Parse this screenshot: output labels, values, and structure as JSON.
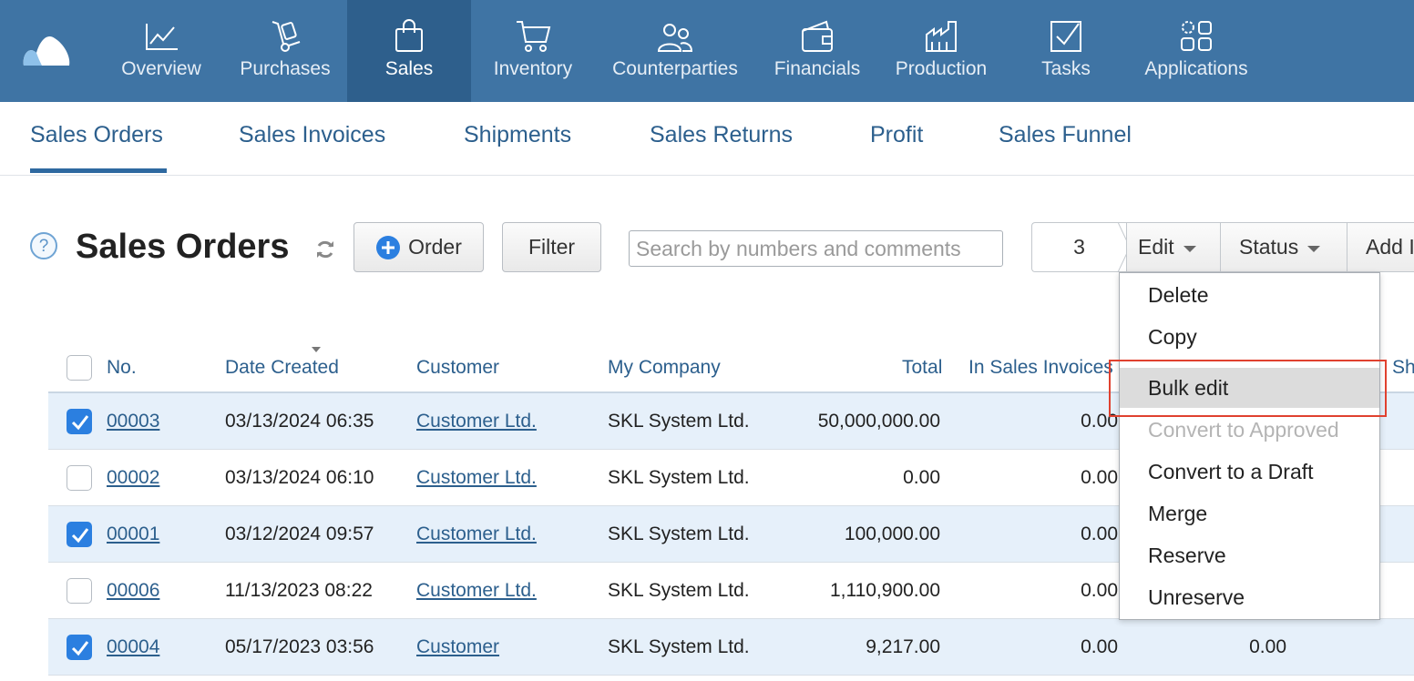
{
  "topnav": {
    "items": [
      {
        "label": "Overview",
        "icon": "chart-line-icon"
      },
      {
        "label": "Purchases",
        "icon": "hand-truck-icon"
      },
      {
        "label": "Sales",
        "icon": "shopping-bag-icon"
      },
      {
        "label": "Inventory",
        "icon": "cart-icon"
      },
      {
        "label": "Counterparties",
        "icon": "people-icon"
      },
      {
        "label": "Financials",
        "icon": "wallet-icon"
      },
      {
        "label": "Production",
        "icon": "factory-icon"
      },
      {
        "label": "Tasks",
        "icon": "checkbox-icon"
      },
      {
        "label": "Applications",
        "icon": "apps-grid-icon"
      }
    ],
    "active": "Sales",
    "bg_color": "#3f74a4",
    "active_color": "#2e5f8c"
  },
  "subnav": {
    "tabs": [
      "Sales Orders",
      "Sales Invoices",
      "Shipments",
      "Sales Returns",
      "Profit",
      "Sales Funnel"
    ],
    "active": "Sales Orders"
  },
  "page": {
    "help": "?",
    "title": "Sales Orders",
    "order_button": "Order",
    "filter_button": "Filter",
    "search_placeholder": "Search by numbers and comments",
    "selected_count": "3",
    "edit_button": "Edit",
    "status_button": "Status",
    "add_button": "Add I"
  },
  "table": {
    "headers": [
      "No.",
      "Date Created",
      "Customer",
      "My Company",
      "Total",
      "In Sales Invoices",
      "Sh"
    ],
    "rows": [
      {
        "checked": true,
        "no": "00003",
        "date": "03/13/2024 06:35",
        "customer": "Customer Ltd.",
        "company": "SKL System Ltd.",
        "total": "50,000,000.00",
        "invoices": "0.00",
        "extra": ""
      },
      {
        "checked": false,
        "no": "00002",
        "date": "03/13/2024 06:10",
        "customer": "Customer Ltd.",
        "company": "SKL System Ltd.",
        "total": "0.00",
        "invoices": "0.00",
        "extra": ""
      },
      {
        "checked": true,
        "no": "00001",
        "date": "03/12/2024 09:57",
        "customer": "Customer Ltd.",
        "company": "SKL System Ltd.",
        "total": "100,000.00",
        "invoices": "0.00",
        "extra": ""
      },
      {
        "checked": false,
        "no": "00006",
        "date": "11/13/2023 08:22",
        "customer": "Customer Ltd.",
        "company": "SKL System Ltd.",
        "total": "1,110,900.00",
        "invoices": "0.00",
        "extra": ""
      },
      {
        "checked": true,
        "no": "00004",
        "date": "05/17/2023 03:56",
        "customer": "Customer",
        "company": "SKL System Ltd.",
        "total": "9,217.00",
        "invoices": "0.00",
        "extra": "0.00"
      }
    ]
  },
  "dropdown": {
    "items": [
      {
        "label": "Delete",
        "state": "normal"
      },
      {
        "label": "Copy",
        "state": "normal"
      },
      {
        "label": "Bulk edit",
        "state": "highlight"
      },
      {
        "label": "Convert to Approved",
        "state": "disabled"
      },
      {
        "label": "Convert to a Draft",
        "state": "normal"
      },
      {
        "label": "Merge",
        "state": "normal"
      },
      {
        "label": "Reserve",
        "state": "normal"
      },
      {
        "label": "Unreserve",
        "state": "normal"
      }
    ]
  }
}
